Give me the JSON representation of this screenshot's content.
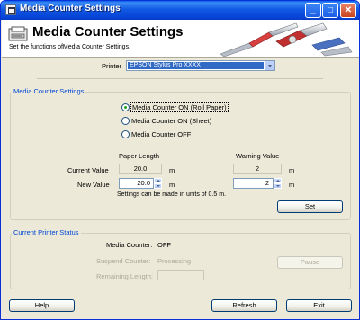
{
  "window": {
    "title": "Media Counter Settings"
  },
  "header": {
    "title": "Media Counter Settings",
    "subtitle": "Set the functions ofMedia Counter Settings."
  },
  "printer": {
    "label": "Printer",
    "selected": "EPSON Stylus Pro XXXX"
  },
  "media_counter_settings": {
    "group_title": "Media Counter Settings",
    "options": [
      {
        "label": "Media Counter ON (Roll Paper)",
        "checked": true
      },
      {
        "label": "Media Counter ON (Sheet)",
        "checked": false
      },
      {
        "label": "Media Counter OFF",
        "checked": false
      }
    ],
    "col_paper_length": "Paper Length",
    "col_warning_value": "Warning Value",
    "row_current": "Current Value",
    "row_new": "New Value",
    "current_paper_length": "20.0",
    "new_paper_length": "20.0",
    "current_warning": "2",
    "new_warning": "2",
    "unit": "m",
    "note": "Settings can be made in units of 0.5 m.",
    "set_label": "Set"
  },
  "printer_status": {
    "group_title": "Current Printer Status",
    "media_counter_label": "Media Counter:",
    "media_counter_value": "OFF",
    "suspend_counter_label": "Suspend Counter:",
    "suspend_counter_value": "Processing",
    "remaining_length_label": "Remaining Length:",
    "remaining_length_value": "",
    "pause_label": "Pause"
  },
  "footer": {
    "help_label": "Help",
    "refresh_label": "Refresh",
    "exit_label": "Exit"
  },
  "colors": {
    "titlebar": "#0a5fe8",
    "accent_text": "#0046d5",
    "radio_selected": "#21a121",
    "selection": "#316ac5"
  },
  "icons": [
    "app-icon",
    "minimize-icon",
    "maximize-icon",
    "close-icon",
    "media-counter-icon",
    "tools-illustration",
    "dropdown-arrow-icon",
    "spin-up-icon",
    "spin-down-icon"
  ]
}
